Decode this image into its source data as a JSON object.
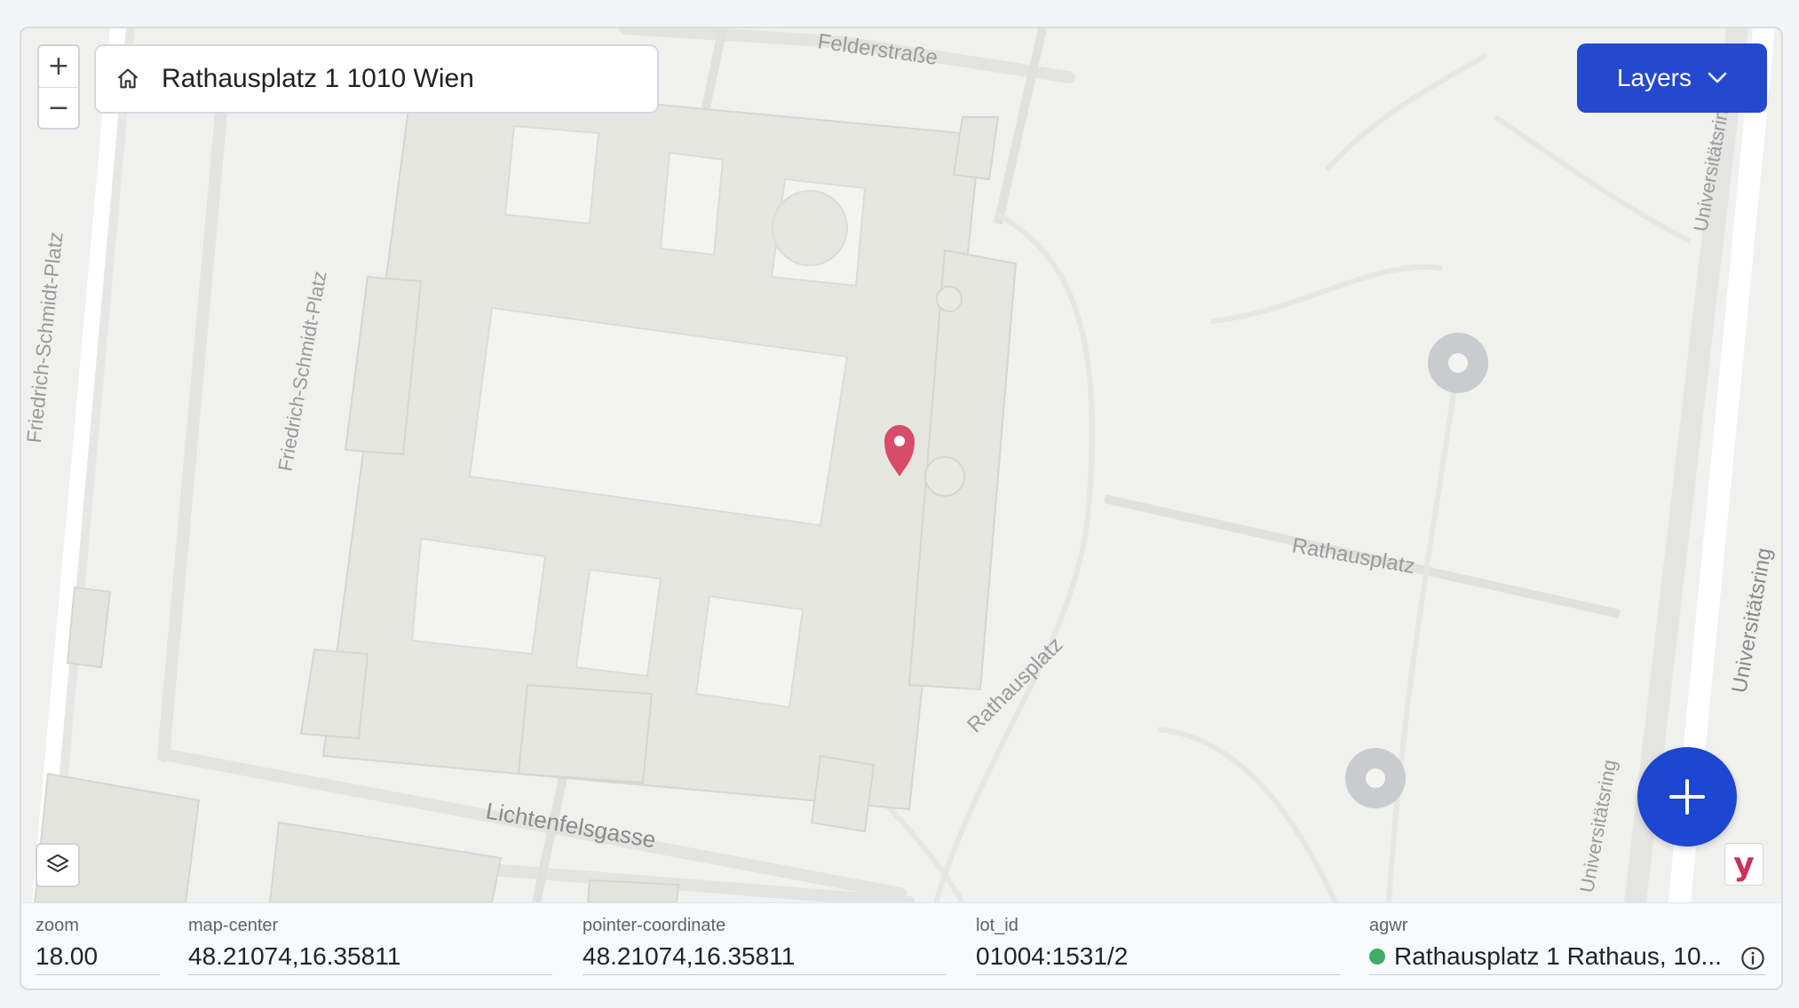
{
  "search": {
    "value": "Rathausplatz 1 1010 Wien",
    "icon": "home-icon"
  },
  "zoom_controls": {
    "in_label": "+",
    "out_label": "−"
  },
  "layers_button": {
    "label": "Layers",
    "icon": "chevron-down-icon"
  },
  "map": {
    "street_labels": {
      "felderstrasse": "Felderstraße",
      "friedrich_left": "Friedrich-Schmidt-Platz",
      "friedrich_mid": "Friedrich-Schmidt-Platz",
      "universitaet_top": "Universitätsring",
      "rathausplatz_east": "Rathausplatz",
      "rathausplatz_diag": "Rathausplatz",
      "lichtenfelsgasse": "Lichtenfelsgasse",
      "universitaetsring_right": "Universitätsring",
      "universitaetsring_low": "Universitätsring"
    },
    "marker_color": "#d84c6a"
  },
  "fab": {
    "icon": "plus-icon",
    "color": "#1d47d0"
  },
  "brand": {
    "letter": "y"
  },
  "status": {
    "zoom": {
      "label": "zoom",
      "value": "18.00"
    },
    "map_center": {
      "label": "map-center",
      "value": "48.21074,16.35811"
    },
    "pointer": {
      "label": "pointer-coordinate",
      "value": "48.21074,16.35811"
    },
    "lot": {
      "label": "lot_id",
      "value": "01004:1531/2"
    },
    "agwr": {
      "label": "agwr",
      "value": "Rathausplatz 1 Rathaus, 10...",
      "status_color": "#3cae66"
    }
  }
}
